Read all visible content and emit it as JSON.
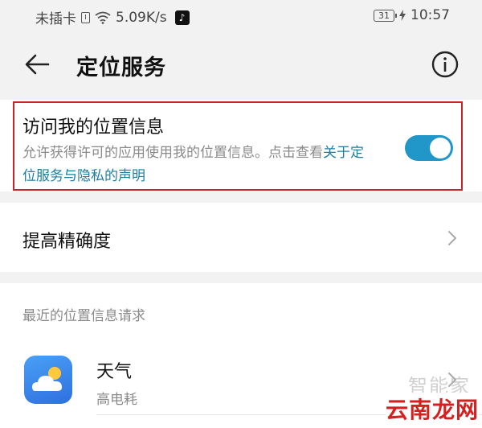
{
  "status_bar": {
    "carrier": "未插卡",
    "speed": "5.09K/s",
    "battery": "31",
    "time": "10:57"
  },
  "header": {
    "title": "定位服务"
  },
  "location_access": {
    "title": "访问我的位置信息",
    "description": "允许获得许可的应用使用我的位置信息。点击查看",
    "link": "关于定位服务与隐私的声明",
    "enabled": true
  },
  "accuracy": {
    "label": "提高精确度"
  },
  "recent_requests": {
    "header": "最近的位置信息请求",
    "items": [
      {
        "name": "天气",
        "subtitle": "高电耗",
        "icon": "weather-app-icon"
      }
    ]
  },
  "watermark": {
    "top": "智能家",
    "bottom": "云南龙网"
  },
  "colors": {
    "accent": "#2196c9",
    "link": "#1a7fa0",
    "highlight": "#c8242a",
    "background": "#f2f2f2"
  }
}
